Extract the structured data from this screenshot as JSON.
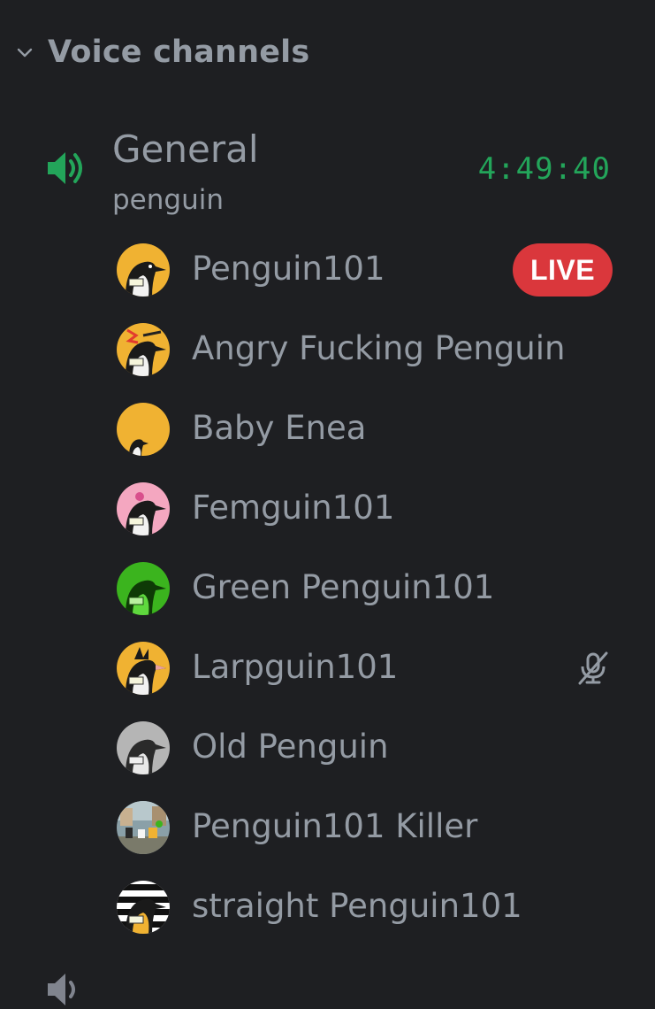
{
  "section": {
    "title": "Voice channels",
    "chevron_icon": "chevron-down-icon"
  },
  "channel": {
    "name": "General",
    "topic": "penguin",
    "elapsed": "4:49:40",
    "icon": "speaker-icon",
    "icon_color": "#23a55a"
  },
  "users": [
    {
      "name": "Penguin101",
      "badge": "LIVE",
      "avatar_bg": "#f0b232"
    },
    {
      "name": "Angry Fucking Penguin",
      "avatar_bg": "#f0b232"
    },
    {
      "name": "Baby Enea",
      "avatar_bg": "#f0b232"
    },
    {
      "name": "Femguin101",
      "avatar_bg": "#f4a7c0"
    },
    {
      "name": "Green Penguin101",
      "avatar_bg": "#3bb41e"
    },
    {
      "name": "Larpguin101",
      "status_icon": "mic-muted-icon",
      "avatar_bg": "#f0b232"
    },
    {
      "name": "Old Penguin",
      "avatar_bg": "#b5b5b5"
    },
    {
      "name": "Penguin101 Killer",
      "avatar_bg": "#8aa0a8"
    },
    {
      "name": "straight Penguin101",
      "avatar_bg": "#ffffff"
    }
  ],
  "colors": {
    "background": "#1e1f22",
    "text_muted": "#949ba4",
    "live_red": "#da373c",
    "voice_green": "#23a55a"
  }
}
